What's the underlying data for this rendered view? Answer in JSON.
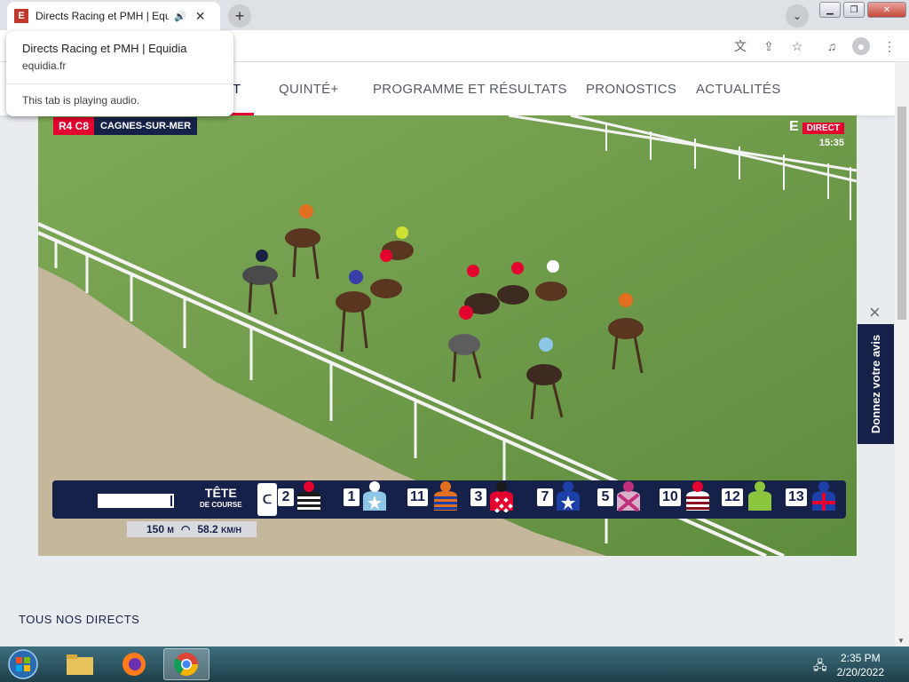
{
  "browser": {
    "tab_title": "Directs Racing et PMH | Equidia",
    "favicon_letter": "E",
    "hovercard": {
      "title": "Directs Racing et PMH | Equidia",
      "url": "equidia.fr",
      "audio_notice": "This tab is playing audio."
    }
  },
  "nav": {
    "active_partial": "T",
    "items": [
      "QUINTÉ+",
      "PROGRAMME ET RÉSULTATS",
      "PRONOSTICS",
      "ACTUALITÉS"
    ]
  },
  "video": {
    "race_code": "R4 C8",
    "venue": "CAGNES-SUR-MER",
    "live_label": "DIRECT",
    "channel_logo": "E",
    "time": "15:35",
    "tete_title": "TÊTE",
    "tete_subtitle": "DE COURSE",
    "race_progress_fraction": 0.97,
    "runners": [
      {
        "number": "2",
        "cap": "#e4032e",
        "body": "#1a1a1a",
        "pattern": "stripes"
      },
      {
        "number": "1",
        "cap": "#ffffff",
        "body": "#8ec6e8",
        "pattern": "star"
      },
      {
        "number": "11",
        "cap": "#e07020",
        "body": "#e07020",
        "pattern": "hoops"
      },
      {
        "number": "3",
        "cap": "#1a1a1a",
        "body": "#e4032e",
        "pattern": "diamonds"
      },
      {
        "number": "7",
        "cap": "#1c3fa8",
        "body": "#1c3fa8",
        "pattern": "star"
      },
      {
        "number": "5",
        "cap": "#c0307a",
        "body": "#d9b0c8",
        "pattern": "cross"
      },
      {
        "number": "10",
        "cap": "#e4032e",
        "body": "#ffffff",
        "pattern": "chevrons"
      },
      {
        "number": "12",
        "cap": "#8cc63f",
        "body": "#8cc63f",
        "pattern": "plain"
      },
      {
        "number": "13",
        "cap": "#1c3fa8",
        "body": "#1c3fa8",
        "pattern": "crossred"
      }
    ],
    "distance": "150",
    "distance_unit": "M",
    "speed": "58.2",
    "speed_unit": "KM/H"
  },
  "feedback": {
    "label": "Donnez votre avis",
    "close": "×"
  },
  "section": {
    "title": "TOUS NOS DIRECTS"
  },
  "taskbar": {
    "time": "2:35 PM",
    "date": "2/20/2022"
  },
  "colors": {
    "brand_red": "#e4032e",
    "brand_navy": "#16214a"
  }
}
